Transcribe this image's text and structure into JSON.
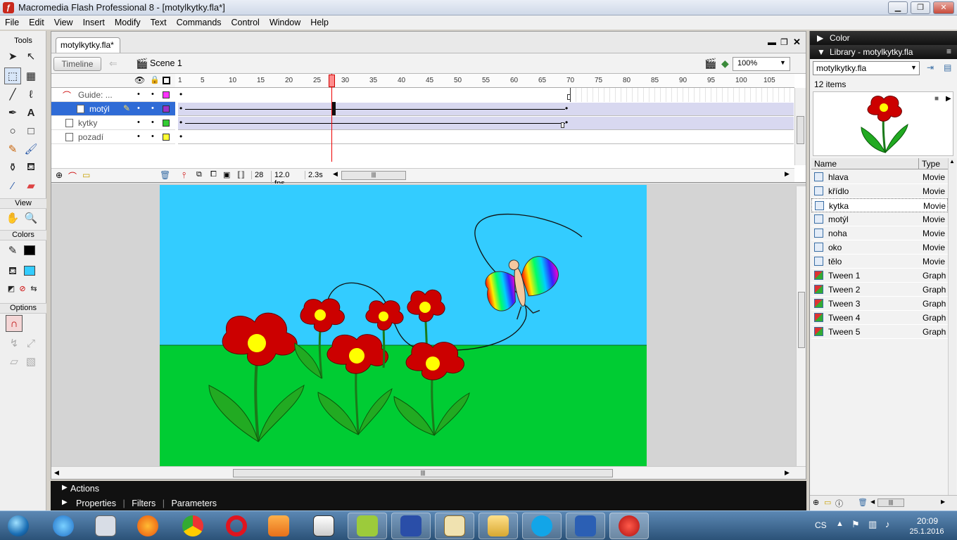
{
  "window": {
    "title": "Macromedia Flash Professional 8 - [motylkytky.fla*]",
    "app_icon": "flash-icon",
    "controls": [
      "minimize",
      "maximize",
      "close"
    ]
  },
  "menu": [
    "File",
    "Edit",
    "View",
    "Insert",
    "Modify",
    "Text",
    "Commands",
    "Control",
    "Window",
    "Help"
  ],
  "tools": {
    "header": "Tools",
    "view_label": "View",
    "colors_label": "Colors",
    "options_label": "Options",
    "stroke_color": "#000000",
    "fill_color": "#33ccff"
  },
  "document": {
    "tab": "motylkytky.fla*",
    "timeline_button": "Timeline",
    "scene": "Scene 1",
    "zoom": "100%",
    "frame_ruler": [
      "1",
      "5",
      "10",
      "15",
      "20",
      "25",
      "30",
      "35",
      "40",
      "45",
      "50",
      "55",
      "60",
      "65",
      "70",
      "75",
      "80",
      "85",
      "90",
      "95",
      "100",
      "105"
    ],
    "current_frame": "28",
    "fps": "12.0 fps",
    "elapsed": "2.3s",
    "layers": [
      {
        "name": "Guide: ...",
        "color": "#ff33ff"
      },
      {
        "name": "motýl",
        "color": "#9933cc",
        "selected": true
      },
      {
        "name": "kytky",
        "color": "#33cc33"
      },
      {
        "name": "pozadí",
        "color": "#ffff33"
      }
    ]
  },
  "panels": {
    "color_header": "Color",
    "library_header": "Library - motylkytky.fla",
    "library_select": "motylkytky.fla",
    "item_count": "12 items",
    "columns": [
      "Name",
      "Type"
    ],
    "items": [
      {
        "name": "hlava",
        "type": "Movie"
      },
      {
        "name": "křídlo",
        "type": "Movie"
      },
      {
        "name": "kytka",
        "type": "Movie"
      },
      {
        "name": "motýl",
        "type": "Movie"
      },
      {
        "name": "noha",
        "type": "Movie"
      },
      {
        "name": "oko",
        "type": "Movie"
      },
      {
        "name": "tělo",
        "type": "Movie"
      },
      {
        "name": "Tween 1",
        "type": "Graph"
      },
      {
        "name": "Tween 2",
        "type": "Graph"
      },
      {
        "name": "Tween 3",
        "type": "Graph"
      },
      {
        "name": "Tween 4",
        "type": "Graph"
      },
      {
        "name": "Tween 5",
        "type": "Graph"
      }
    ]
  },
  "bottom_panels": {
    "actions": "Actions",
    "properties": "Properties",
    "filters": "Filters",
    "parameters": "Parameters"
  },
  "taskbar": {
    "language": "CS",
    "time": "20:09",
    "date": "25.1.2016",
    "apps": [
      "start-orb",
      "internet-explorer",
      "calculator",
      "firefox",
      "chrome",
      "opera",
      "media-player",
      "notepad",
      "android-sdk",
      "save-disk",
      "paint",
      "file-explorer",
      "skype",
      "word",
      "flash"
    ]
  }
}
